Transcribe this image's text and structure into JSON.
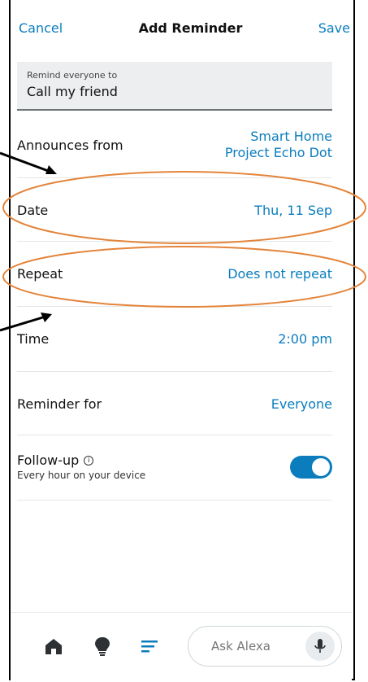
{
  "header": {
    "cancel": "Cancel",
    "title": "Add Reminder",
    "save": "Save"
  },
  "remind": {
    "label": "Remind everyone to",
    "value": "Call my friend"
  },
  "rows": {
    "announces": {
      "label": "Announces from",
      "value_line1": "Smart Home",
      "value_line2": "Project Echo Dot"
    },
    "date": {
      "label": "Date",
      "value": "Thu, 11 Sep"
    },
    "repeat": {
      "label": "Repeat",
      "value": "Does not repeat"
    },
    "time": {
      "label": "Time",
      "value": "2:00 pm"
    },
    "reminder_for": {
      "label": "Reminder for",
      "value": "Everyone"
    },
    "followup": {
      "title": "Follow-up",
      "info_icon": "info-icon",
      "subtitle": "Every hour on your device",
      "enabled": true
    }
  },
  "bottom_bar": {
    "icons": [
      "home-icon",
      "bulb-icon",
      "list-icon",
      "mic-icon"
    ],
    "ask_placeholder": "Ask Alexa"
  },
  "colors": {
    "accent": "#0b7dbd",
    "annotation": "#e4843a"
  }
}
